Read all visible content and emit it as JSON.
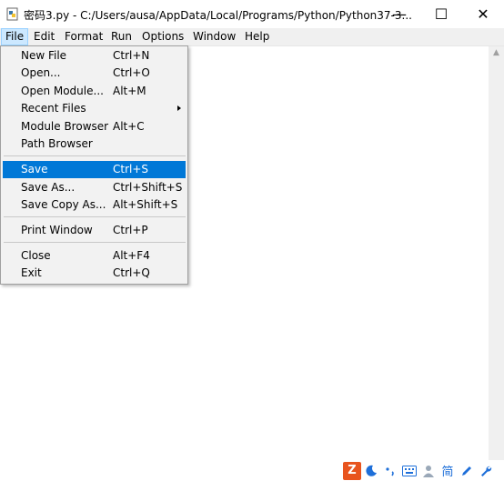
{
  "window": {
    "title": "密码3.py - C:/Users/ausa/AppData/Local/Programs/Python/Python37-3...",
    "minimize_glyph": "—",
    "maximize_glyph": "☐",
    "close_glyph": "✕"
  },
  "menubar": {
    "items": [
      "File",
      "Edit",
      "Format",
      "Run",
      "Options",
      "Window",
      "Help"
    ],
    "active": "File"
  },
  "file_menu": {
    "items": [
      {
        "label": "New File",
        "shortcut": "Ctrl+N"
      },
      {
        "label": "Open...",
        "shortcut": "Ctrl+O"
      },
      {
        "label": "Open Module...",
        "shortcut": "Alt+M"
      },
      {
        "label": "Recent Files",
        "shortcut": ""
      },
      {
        "label": "Module Browser",
        "shortcut": "Alt+C"
      },
      {
        "label": "Path Browser",
        "shortcut": ""
      },
      {
        "label": "Save",
        "shortcut": "Ctrl+S"
      },
      {
        "label": "Save As...",
        "shortcut": "Ctrl+Shift+S"
      },
      {
        "label": "Save Copy As...",
        "shortcut": "Alt+Shift+S"
      },
      {
        "label": "Print Window",
        "shortcut": "Ctrl+P"
      },
      {
        "label": "Close",
        "shortcut": "Alt+F4"
      },
      {
        "label": "Exit",
        "shortcut": "Ctrl+Q"
      }
    ],
    "highlighted": "Save"
  },
  "ime_toolbar": {
    "icons": [
      "ime-logo-icon",
      "moon-icon",
      "punctuation-icon",
      "keyboard-icon",
      "user-icon",
      "simplified-chinese-icon",
      "pen-icon",
      "wrench-icon"
    ],
    "logo_glyph": "Z",
    "simplified_char": "简"
  },
  "colors": {
    "highlight": "#0078d7",
    "menu_bg": "#f2f2f2",
    "active_menu_bg": "#cce8ff",
    "ime_logo": "#e8541e"
  }
}
